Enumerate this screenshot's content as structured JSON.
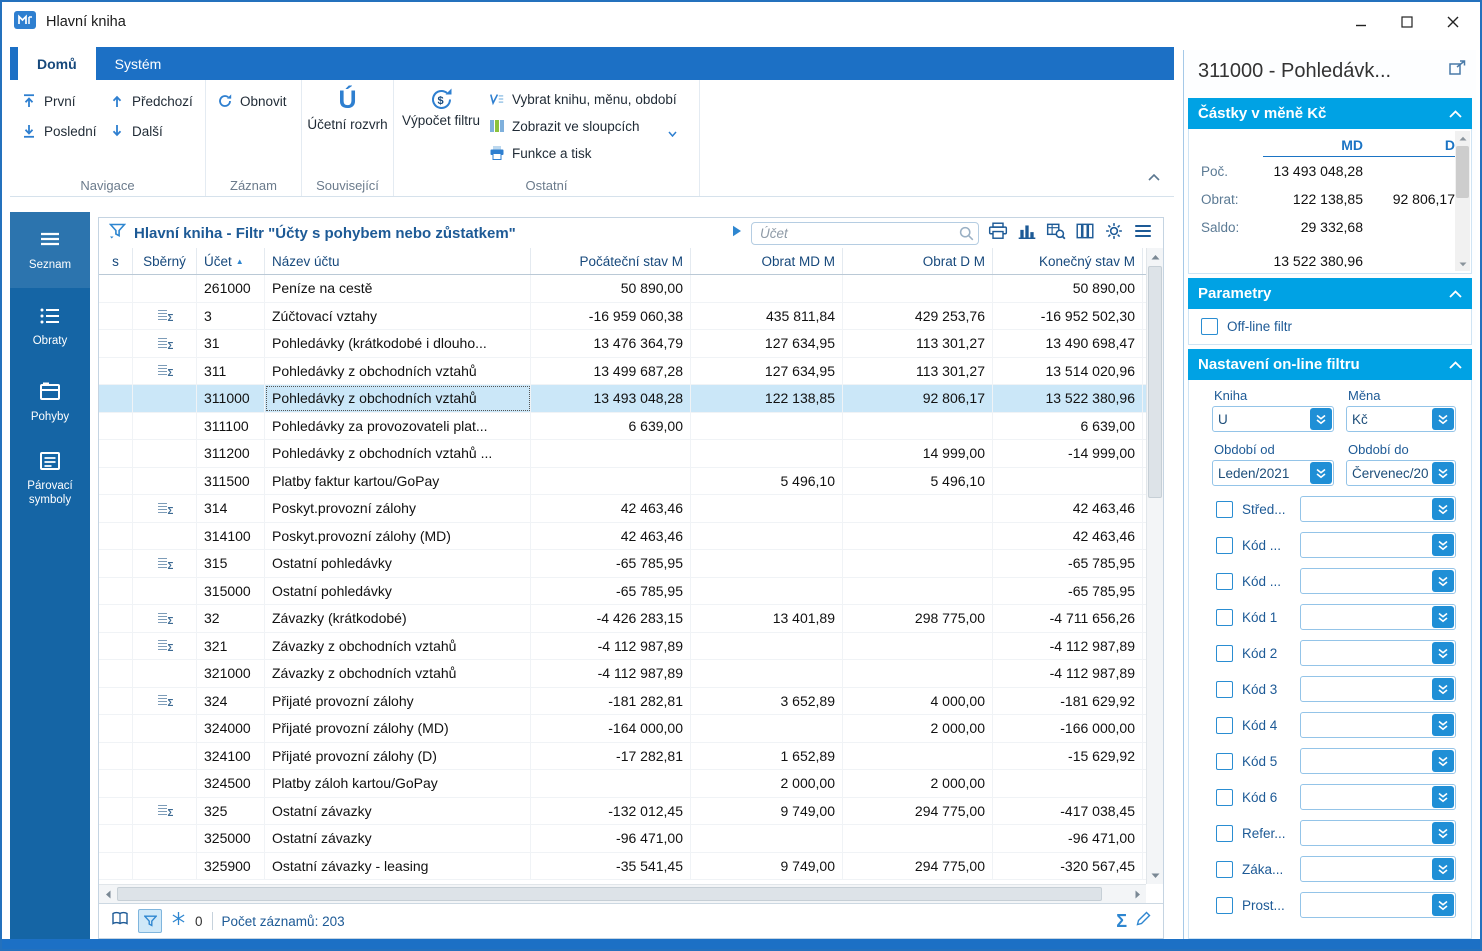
{
  "window": {
    "title": "Hlavní kniha"
  },
  "icons": {
    "sum": "Σ",
    "sort_asc": "▲"
  },
  "ribbon": {
    "tabs": [
      {
        "label": "Domů"
      },
      {
        "label": "Systém"
      }
    ],
    "buttons": {
      "first": "První",
      "prev": "Předchozí",
      "last": "Poslední",
      "next": "Další",
      "refresh": "Obnovit",
      "chart_of_accounts": "Účetní rozvrh",
      "chart_of_accounts_icon_letter": "Ú",
      "filter_calc": "Výpočet filtru",
      "select_book": "Vybrat knihu, měnu, období",
      "show_columns": "Zobrazit ve sloupcích",
      "functions_print": "Funkce a tisk"
    },
    "group_labels": {
      "navigace": "Navigace",
      "zaznam": "Záznam",
      "souvisejici": "Související",
      "ostatni": "Ostatní"
    }
  },
  "sidebar": {
    "items": [
      {
        "label": "Seznam",
        "active": true
      },
      {
        "label": "Obraty"
      },
      {
        "label": "Pohyby"
      },
      {
        "label": "Párovací symboly"
      }
    ]
  },
  "grid": {
    "title": "Hlavní kniha - Filtr \"Účty s pohybem nebo zůstatkem\"",
    "search_placeholder": "Účet",
    "columns": [
      "s",
      "Sběrný",
      "Účet",
      "Název účtu",
      "Počáteční stav M",
      "Obrat MD M",
      "Obrat D M",
      "Konečný stav M"
    ],
    "sort_column": "Účet",
    "rows": [
      {
        "sberny": false,
        "selected": false,
        "ucet": "261000",
        "nazev": "Peníze na cestě",
        "pocatecni": "50 890,00",
        "md": "",
        "d": "",
        "konecny": "50 890,00"
      },
      {
        "sberny": true,
        "selected": false,
        "ucet": "3",
        "nazev": "Zúčtovací vztahy",
        "pocatecni": "-16 959 060,38",
        "md": "435 811,84",
        "d": "429 253,76",
        "konecny": "-16 952 502,30"
      },
      {
        "sberny": true,
        "selected": false,
        "ucet": "31",
        "nazev": "Pohledávky (krátkodobé i dlouho...",
        "pocatecni": "13 476 364,79",
        "md": "127 634,95",
        "d": "113 301,27",
        "konecny": "13 490 698,47"
      },
      {
        "sberny": true,
        "selected": false,
        "ucet": "311",
        "nazev": "Pohledávky z obchodních vztahů",
        "pocatecni": "13 499 687,28",
        "md": "127 634,95",
        "d": "113 301,27",
        "konecny": "13 514 020,96"
      },
      {
        "sberny": false,
        "selected": true,
        "ucet": "311000",
        "nazev": "Pohledávky z obchodních vztahů",
        "pocatecni": "13 493 048,28",
        "md": "122 138,85",
        "d": "92 806,17",
        "konecny": "13 522 380,96"
      },
      {
        "sberny": false,
        "selected": false,
        "ucet": "311100",
        "nazev": "Pohledávky za provozovateli plat...",
        "pocatecni": "6 639,00",
        "md": "",
        "d": "",
        "konecny": "6 639,00"
      },
      {
        "sberny": false,
        "selected": false,
        "ucet": "311200",
        "nazev": "Pohledávky z obchodních vztahů ...",
        "pocatecni": "",
        "md": "",
        "d": "14 999,00",
        "konecny": "-14 999,00"
      },
      {
        "sberny": false,
        "selected": false,
        "ucet": "311500",
        "nazev": "Platby faktur kartou/GoPay",
        "pocatecni": "",
        "md": "5 496,10",
        "d": "5 496,10",
        "konecny": ""
      },
      {
        "sberny": true,
        "selected": false,
        "ucet": "314",
        "nazev": "Poskyt.provozní zálohy",
        "pocatecni": "42 463,46",
        "md": "",
        "d": "",
        "konecny": "42 463,46"
      },
      {
        "sberny": false,
        "selected": false,
        "ucet": "314100",
        "nazev": "Poskyt.provozní zálohy (MD)",
        "pocatecni": "42 463,46",
        "md": "",
        "d": "",
        "konecny": "42 463,46"
      },
      {
        "sberny": true,
        "selected": false,
        "ucet": "315",
        "nazev": "Ostatní pohledávky",
        "pocatecni": "-65 785,95",
        "md": "",
        "d": "",
        "konecny": "-65 785,95"
      },
      {
        "sberny": false,
        "selected": false,
        "ucet": "315000",
        "nazev": "Ostatní pohledávky",
        "pocatecni": "-65 785,95",
        "md": "",
        "d": "",
        "konecny": "-65 785,95"
      },
      {
        "sberny": true,
        "selected": false,
        "ucet": "32",
        "nazev": "Závazky (krátkodobé)",
        "pocatecni": "-4 426 283,15",
        "md": "13 401,89",
        "d": "298 775,00",
        "konecny": "-4 711 656,26"
      },
      {
        "sberny": true,
        "selected": false,
        "ucet": "321",
        "nazev": "Závazky z obchodních vztahů",
        "pocatecni": "-4 112 987,89",
        "md": "",
        "d": "",
        "konecny": "-4 112 987,89"
      },
      {
        "sberny": false,
        "selected": false,
        "ucet": "321000",
        "nazev": "Závazky z obchodních vztahů",
        "pocatecni": "-4 112 987,89",
        "md": "",
        "d": "",
        "konecny": "-4 112 987,89"
      },
      {
        "sberny": true,
        "selected": false,
        "ucet": "324",
        "nazev": "Přijaté provozní zálohy",
        "pocatecni": "-181 282,81",
        "md": "3 652,89",
        "d": "4 000,00",
        "konecny": "-181 629,92"
      },
      {
        "sberny": false,
        "selected": false,
        "ucet": "324000",
        "nazev": "Přijaté provozní zálohy (MD)",
        "pocatecni": "-164 000,00",
        "md": "",
        "d": "2 000,00",
        "konecny": "-166 000,00"
      },
      {
        "sberny": false,
        "selected": false,
        "ucet": "324100",
        "nazev": "Přijaté provozní zálohy (D)",
        "pocatecni": "-17 282,81",
        "md": "1 652,89",
        "d": "",
        "konecny": "-15 629,92"
      },
      {
        "sberny": false,
        "selected": false,
        "ucet": "324500",
        "nazev": "Platby záloh kartou/GoPay",
        "pocatecni": "",
        "md": "2 000,00",
        "d": "2 000,00",
        "konecny": ""
      },
      {
        "sberny": true,
        "selected": false,
        "ucet": "325",
        "nazev": "Ostatní závazky",
        "pocatecni": "-132 012,45",
        "md": "9 749,00",
        "d": "294 775,00",
        "konecny": "-417 038,45"
      },
      {
        "sberny": false,
        "selected": false,
        "ucet": "325000",
        "nazev": "Ostatní závazky",
        "pocatecni": "-96 471,00",
        "md": "",
        "d": "",
        "konecny": "-96 471,00"
      },
      {
        "sberny": false,
        "selected": false,
        "ucet": "325900",
        "nazev": "Ostatní závazky - leasing",
        "pocatecni": "-35 541,45",
        "md": "9 749,00",
        "d": "294 775,00",
        "konecny": "-320 567,45"
      }
    ],
    "status": {
      "freeze_count": "0",
      "records": "Počet záznamů: 203"
    }
  },
  "detail": {
    "title": "311000 - Pohledávk...",
    "amounts": {
      "header": "Částky v měně Kč",
      "col_md": "MD",
      "col_d": "D",
      "rows": [
        {
          "label": "Poč.",
          "md": "13 493 048,28",
          "d": ""
        },
        {
          "label": "Obrat:",
          "md": "122 138,85",
          "d": "92 806,17"
        },
        {
          "label": "Saldo:",
          "md": "29 332,68",
          "d": ""
        },
        {
          "label": "",
          "md": "13 522 380,96",
          "d": ""
        }
      ]
    },
    "parameters": {
      "header": "Parametry",
      "offline_filter_label": "Off-line filtr"
    },
    "online_filter": {
      "header": "Nastavení on-line filtru",
      "kniha_label": "Kniha",
      "kniha_value": "U",
      "mena_label": "Měna",
      "mena_value": "Kč",
      "obdobi_od_label": "Období od",
      "obdobi_od_value": "Leden/2021",
      "obdobi_do_label": "Období do",
      "obdobi_do_value": "Červenec/20",
      "filters": [
        {
          "label": "Střed..."
        },
        {
          "label": "Kód ..."
        },
        {
          "label": "Kód ..."
        },
        {
          "label": "Kód 1"
        },
        {
          "label": "Kód 2"
        },
        {
          "label": "Kód 3"
        },
        {
          "label": "Kód 4"
        },
        {
          "label": "Kód 5"
        },
        {
          "label": "Kód 6"
        },
        {
          "label": "Refer..."
        },
        {
          "label": "Záka..."
        },
        {
          "label": "Prost..."
        }
      ]
    }
  }
}
